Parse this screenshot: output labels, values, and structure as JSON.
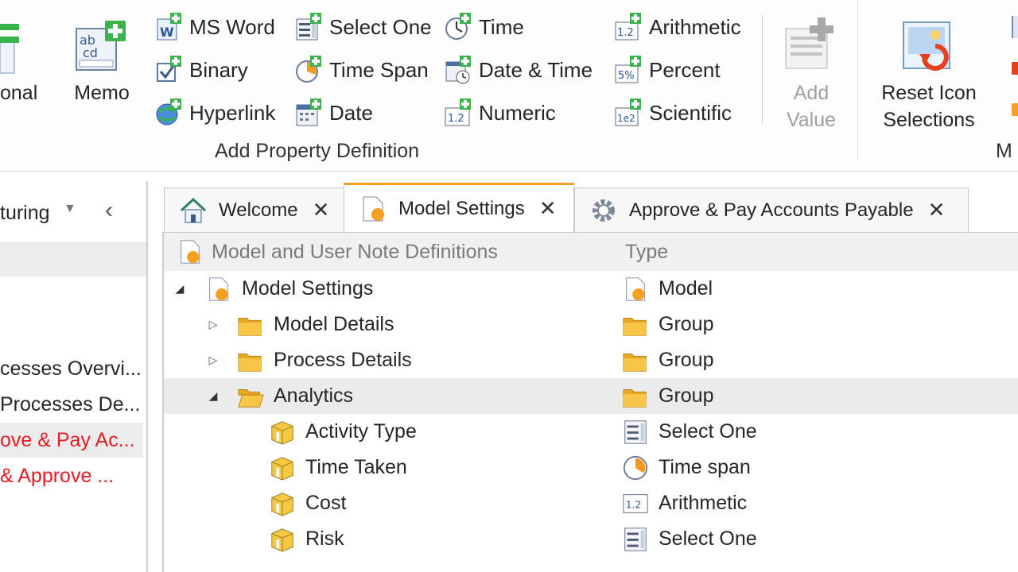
{
  "ribbon": {
    "partial_button_1": "onal",
    "memo": "Memo",
    "col1": [
      "MS Word",
      "Binary",
      "Hyperlink"
    ],
    "col2": [
      "Select One",
      "Time Span",
      "Date"
    ],
    "col3": [
      "Time",
      "Date & Time",
      "Numeric"
    ],
    "col4": [
      "Arithmetic",
      "Percent",
      "Scientific"
    ],
    "add_value_line1": "Add",
    "add_value_line2": "Value",
    "reset_line1": "Reset Icon",
    "reset_line2": "Selections",
    "group_label": "Add Property Definition",
    "partial_group_label": "M"
  },
  "left_panel": {
    "header": "turing",
    "items": [
      {
        "label": "cesses Overvi...",
        "red": false
      },
      {
        "label": "Processes De...",
        "red": false
      },
      {
        "label": "ove & Pay Ac...",
        "red": true,
        "highlight": true
      },
      {
        "label": "& Approve ...",
        "red": true
      }
    ]
  },
  "tabs": [
    {
      "label": "Welcome",
      "icon": "house-icon"
    },
    {
      "label": "Model Settings",
      "icon": "model-settings-icon",
      "active": true
    },
    {
      "label": "Approve & Pay Accounts Payable",
      "icon": "gear-icon"
    }
  ],
  "grid": {
    "col_name": "Model and User Note Definitions",
    "col_type": "Type",
    "rows": [
      {
        "name": "Model Settings",
        "type": "Model"
      },
      {
        "name": "Model Details",
        "type": "Group"
      },
      {
        "name": "Process Details",
        "type": "Group"
      },
      {
        "name": "Analytics",
        "type": "Group"
      },
      {
        "name": "Activity Type",
        "type": "Select One"
      },
      {
        "name": "Time Taken",
        "type": "Time span"
      },
      {
        "name": "Cost",
        "type": "Arithmetic"
      },
      {
        "name": "Risk",
        "type": "Select One"
      }
    ]
  },
  "colors": {
    "accent": "#f5a020",
    "red_text": "#e51c23",
    "green_plus": "#3ab34a"
  }
}
